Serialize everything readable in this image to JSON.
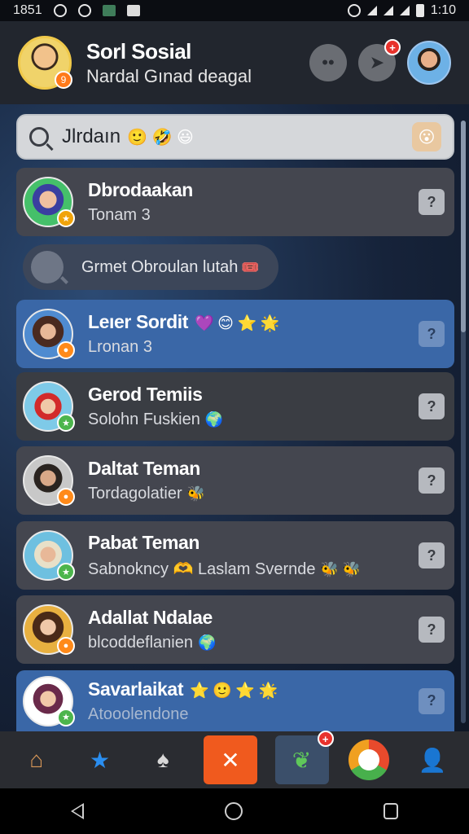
{
  "status_bar": {
    "time_left": "1851",
    "time_right": "1:10"
  },
  "header": {
    "title": "Sorl Sosial",
    "subtitle": "Nardal Gınad deagal",
    "profile_badge": "9",
    "notif_count": "+"
  },
  "search": {
    "value": "Jlrdaın",
    "emojis": "🙂 🤣 😃",
    "mood_icon": "😮"
  },
  "bubble": {
    "text": "Grmet Obroulan lutah",
    "emoji": "🎟️"
  },
  "contacts": [
    {
      "name": "Dbrodaakan",
      "name_emoji": "",
      "sub": "Tonam 3",
      "sub_emoji": "",
      "action": "?",
      "badge": ""
    },
    {
      "name": "Leıer Sordit",
      "name_emoji": "💜 😊 ⭐ 🌟",
      "sub": "Lronan 3",
      "sub_emoji": "",
      "action": "?",
      "badge": ""
    },
    {
      "name": "Gerod Temiis",
      "name_emoji": "",
      "sub": "Solohn Fuskien",
      "sub_emoji": "🌍",
      "action": "?",
      "badge": ""
    },
    {
      "name": "Daltat Teman",
      "name_emoji": "",
      "sub": "Tordagolatier",
      "sub_emoji": "🐝",
      "action": "?",
      "badge": ""
    },
    {
      "name": "Pabat Teman",
      "name_emoji": "",
      "sub": "Sabnokncy 🫶 Laslam Svernde",
      "sub_emoji": "🐝 🐝",
      "action": "?",
      "badge": ""
    },
    {
      "name": "Adallat Ndalae",
      "name_emoji": "",
      "sub": "blcoddeflanien",
      "sub_emoji": "🌍",
      "action": "?",
      "badge": ""
    },
    {
      "name": "Savarlaikat",
      "name_emoji": "⭐ 🙂 ⭐ 🌟",
      "sub": "Atooolendone",
      "sub_emoji": "",
      "action": "?",
      "badge": ""
    }
  ],
  "bottom_nav": [
    {
      "icon": "home-icon",
      "label": "⌂"
    },
    {
      "icon": "star-icon",
      "label": "★"
    },
    {
      "icon": "tree-icon",
      "label": "♠"
    },
    {
      "icon": "wifi-off-icon",
      "label": "✕"
    },
    {
      "icon": "chat-icon",
      "label": "❦"
    },
    {
      "icon": "location-icon",
      "label": ""
    },
    {
      "icon": "person-icon",
      "label": "👤"
    }
  ],
  "chat_notif": "+"
}
